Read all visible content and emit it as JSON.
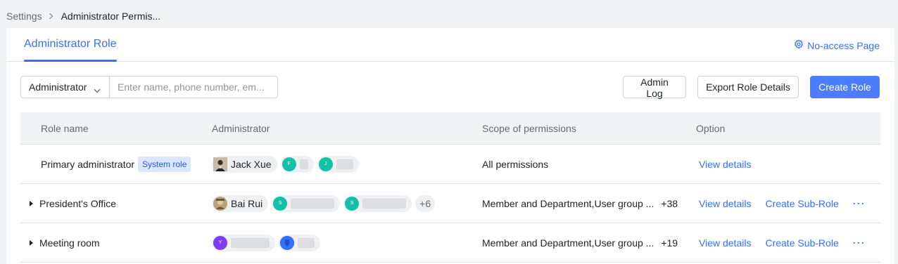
{
  "breadcrumb": {
    "parent": "Settings",
    "current": "Administrator Permis..."
  },
  "tabs": [
    {
      "label": "Administrator Role"
    }
  ],
  "no_access_page": "No-access Page",
  "toolbar": {
    "filter_selected": "Administrator",
    "search_placeholder": "Enter name, phone number, em...",
    "admin_log": "Admin Log",
    "export": "Export Role Details",
    "create": "Create Role"
  },
  "table": {
    "columns": [
      "Role name",
      "Administrator",
      "Scope of permissions",
      "Option"
    ],
    "rows": [
      {
        "role": "Primary administrator",
        "tag": "System role",
        "admins": [
          {
            "name": "Jack Xue"
          },
          {
            "initial": "F"
          },
          {
            "initial": "J"
          }
        ],
        "scope": "All permissions",
        "view": "View details"
      },
      {
        "role": "President's Office",
        "admins": [
          {
            "name": "Bai Rui"
          },
          {
            "initial": "S"
          },
          {
            "initial": "S"
          }
        ],
        "more": "+6",
        "scope": "Member and Department,User group ...",
        "scope_more": "+38",
        "view": "View details",
        "sub_role": "Create Sub-Role"
      },
      {
        "role": "Meeting room",
        "admins": [
          {
            "initial": "Y"
          },
          {
            "initial": ""
          }
        ],
        "scope": "Member and Department,User group ...",
        "scope_more": "+19",
        "view": "View details",
        "sub_role": "Create Sub-Role"
      }
    ]
  },
  "colors": {
    "accent": "#3370ff",
    "primary_button": "#4c7dff",
    "teal_avatar": "#14c0a6",
    "purple_avatar": "#7f3bf5",
    "blue_avatar": "#3370ff"
  },
  "icons": [
    "chevron-right-icon",
    "gear-icon",
    "chevron-down-icon",
    "caret-right-icon",
    "more-icon"
  ]
}
